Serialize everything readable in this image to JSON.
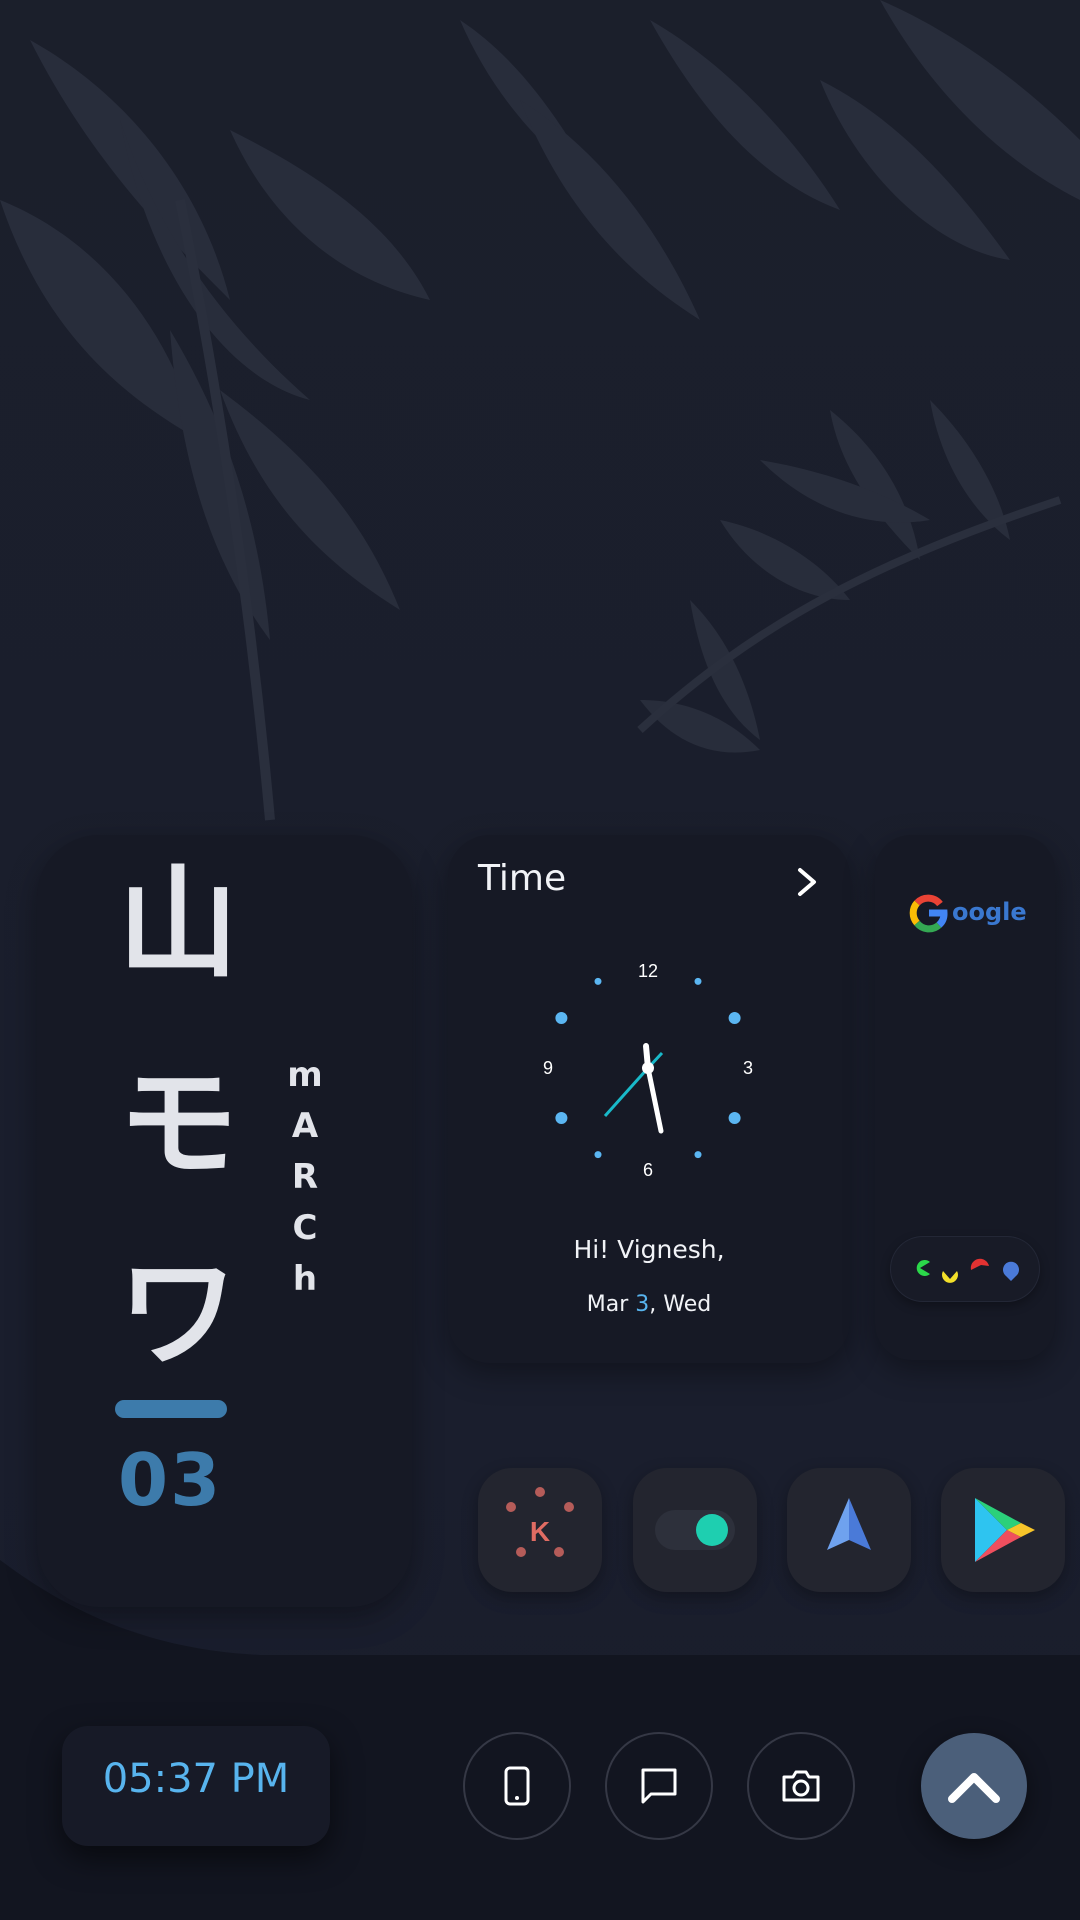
{
  "date_widget": {
    "day_kanji": [
      "山",
      "モ",
      "ワ"
    ],
    "month_letters": [
      "m",
      "A",
      "R",
      "C",
      "h"
    ],
    "day_number": "03"
  },
  "time_widget": {
    "title": "Time",
    "dial_numbers": [
      "12",
      "3",
      "6",
      "9"
    ],
    "greeting": "Hi! Vignesh,",
    "date_prefix": "Mar ",
    "date_day": "3",
    "date_suffix": ", Wed"
  },
  "google_widget": {
    "word": "oogle"
  },
  "app_icons": [
    "k-dots-icon",
    "toggle-icon",
    "navigation-arrow-icon",
    "play-store-icon"
  ],
  "dock": {
    "clock_text": "05:37 PM",
    "buttons": [
      "phone-icon",
      "message-icon",
      "camera-icon"
    ],
    "drawer_icon": "chevron-up-icon"
  },
  "colors": {
    "accent_blue": "#58b4ee",
    "date_blue": "#3d7bab",
    "card_bg": "#161925",
    "drawer_button": "#4b5f7a"
  }
}
